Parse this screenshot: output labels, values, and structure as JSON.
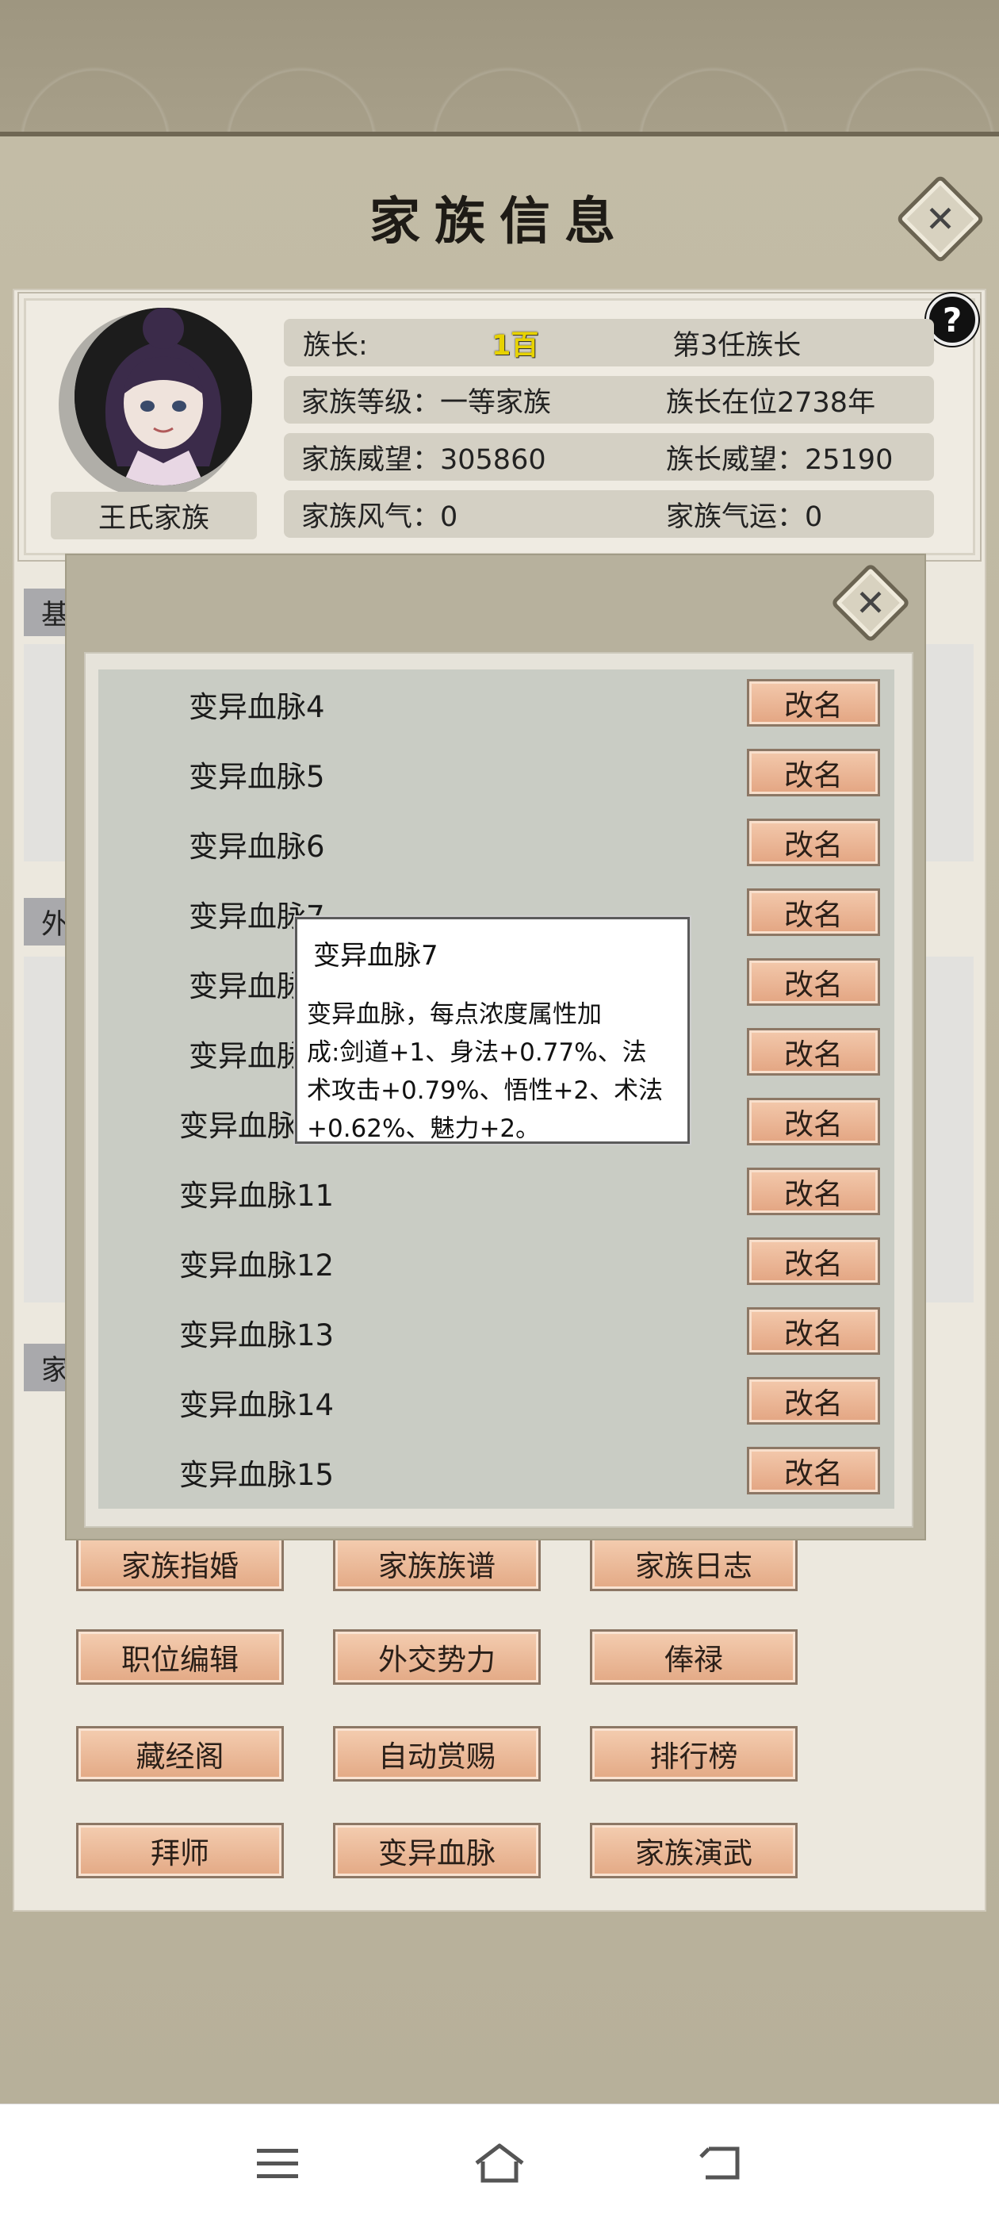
{
  "header": {
    "title": "家族信息"
  },
  "info": {
    "family_name": "王氏家族",
    "leader_label": "族长:",
    "leader_name": "1百",
    "leader_term": "第3任族长",
    "family_level": "家族等级：一等家族",
    "leader_tenure": "族长在位2738年",
    "family_prestige": "家族威望：305860",
    "leader_prestige": "族长威望：25190",
    "family_style": "家族风气：0",
    "family_luck": "家族气运：0",
    "help": "?"
  },
  "sections": {
    "tab1": "基",
    "tab2": "外",
    "tab3": "家"
  },
  "buttons": {
    "row1": [
      "家族指婚",
      "家族族谱",
      "家族日志"
    ],
    "row2": [
      "职位编辑",
      "外交势力",
      "俸禄"
    ],
    "row3": [
      "藏经阁",
      "自动赏赐",
      "排行榜"
    ],
    "row4": [
      "拜师",
      "变异血脉",
      "家族演武"
    ]
  },
  "modal": {
    "close": "✕",
    "rename_label": "改名",
    "bloodlines": [
      "变异血脉4",
      "变异血脉5",
      "变异血脉6",
      "变异血脉7",
      "变异血脉8",
      "变异血脉9",
      "变异血脉10",
      "变异血脉11",
      "变异血脉12",
      "变异血脉13",
      "变异血脉14",
      "变异血脉15"
    ],
    "visible_names": [
      "变异血脉4",
      "变异血脉5",
      "变异血脉6",
      "变异血脉7",
      "变异血脉",
      "变异血脉",
      "变异血脉",
      "变异血脉11",
      "变异血脉12",
      "变异血脉13",
      "变异血脉14",
      "变异血脉15"
    ]
  },
  "tooltip": {
    "title": "变异血脉7",
    "line1": "变异血脉，每点浓度属性加",
    "line2": "成:剑道+1、身法+0.77%、法",
    "line3": "术攻击+0.79%、悟性+2、术法",
    "line4": "+0.62%、魅力+2。"
  },
  "nav": {
    "menu_icon": "menu-icon",
    "home_icon": "home-icon",
    "back_icon": "back-icon"
  },
  "colors": {
    "accent_button": "#e3a985",
    "leader_name": "#e7d200"
  }
}
